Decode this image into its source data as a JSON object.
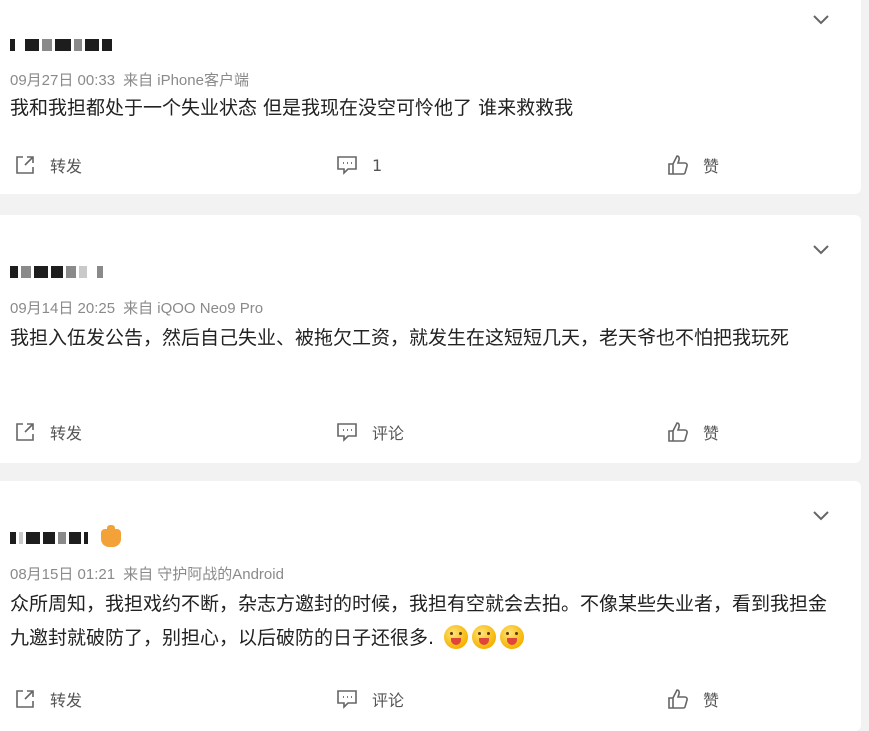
{
  "posts": [
    {
      "time": "09月27日 00:33",
      "source": "来自 iPhone客户端",
      "text": "我和我担都处于一个失业状态 但是我现在没空可怜他了 谁来救救我",
      "forward_label": "转发",
      "comment_label": "1",
      "like_label": "赞"
    },
    {
      "time": "09月14日 20:25",
      "source": "来自 iQOO Neo9 Pro",
      "text": "我担入伍发公告，然后自己失业、被拖欠工资，就发生在这短短几天，老天爷也不怕把我玩死",
      "forward_label": "转发",
      "comment_label": "评论",
      "like_label": "赞"
    },
    {
      "time": "08月15日 01:21",
      "source": "来自 守护阿战的Android",
      "text": "众所周知，我担戏约不断，杂志方邀封的时候，我担有空就会去拍。不像某些失业者，看到我担金九邀封就破防了，别担心，以后破防的日子还很多. ",
      "forward_label": "转发",
      "comment_label": "评论",
      "like_label": "赞"
    }
  ],
  "icons": {
    "chevron": "chevron-down-icon",
    "forward": "share-out-icon",
    "comment": "comment-bubble-icon",
    "like": "thumbs-up-icon",
    "emoji": "tongue-out-emoji-icon",
    "badge": "fan-badge-icon"
  },
  "colors": {
    "background": "#f2f2f2",
    "card": "#ffffff",
    "meta_text": "#8a8a8a",
    "body_text": "#222222"
  }
}
